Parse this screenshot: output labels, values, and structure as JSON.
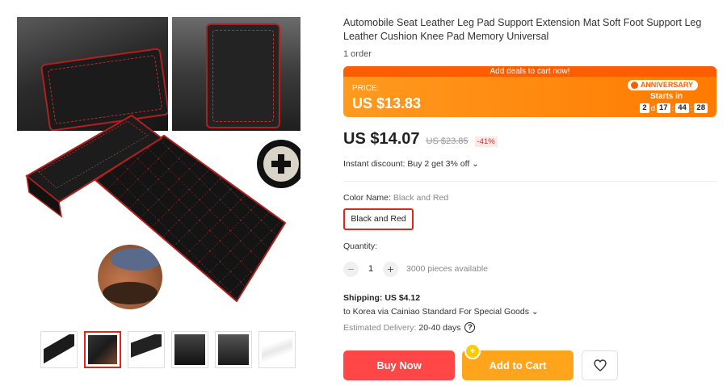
{
  "product": {
    "title": "Automobile Seat Leather Leg Pad Support Extension Mat Soft Foot Support Leg Leather Cushion Knee Pad Memory Universal",
    "orders": "1 order"
  },
  "promo": {
    "banner": "Add deals to cart now!",
    "price_label": "PRICE:",
    "price": "US $13.83",
    "badge": "ANNIVERSARY",
    "starts_in": "Starts in",
    "countdown": {
      "days": "2",
      "days_unit": "d",
      "hours": "17",
      "minutes": "44",
      "seconds": "28",
      "sep": ":"
    }
  },
  "pricing": {
    "current": "US $14.07",
    "original": "US $23.85",
    "discount": "-41%",
    "instant_discount": "Instant discount: Buy 2 get 3% off ⌄"
  },
  "color": {
    "label": "Color Name: ",
    "selected": "Black and Red",
    "options": [
      "Black and Red"
    ]
  },
  "quantity": {
    "label": "Quantity:",
    "minus": "−",
    "value": "1",
    "plus": "+",
    "available": "3000 pieces available"
  },
  "shipping": {
    "label": "Shipping: US $4.12",
    "route": "to Korea via Cainiao Standard For Special Goods ⌄",
    "delivery_label": "Estimated Delivery: ",
    "delivery_days": "20-40 days",
    "help_icon": "?"
  },
  "actions": {
    "buy_now": "Buy Now",
    "add_to_cart": "Add to Cart",
    "cart_badge": "+",
    "wishlist_icon": "heart-icon"
  },
  "gallery": {
    "thumbnails": 6,
    "active_index": 1
  },
  "colors": {
    "accent_red": "#ff4747",
    "accent_orange": "#ffa41b",
    "promo_orange": "#ff7a00",
    "discount_red": "#e1251b"
  }
}
